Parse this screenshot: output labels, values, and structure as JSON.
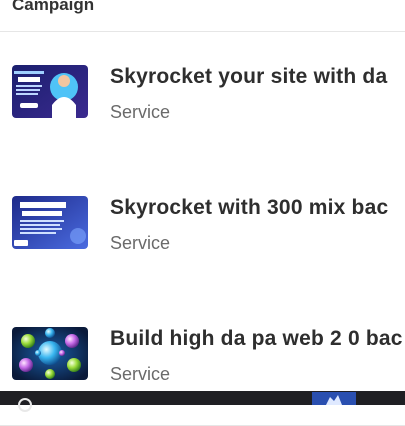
{
  "header": {
    "column_label": "Campaign"
  },
  "rows": [
    {
      "title": "Skyrocket your site with da",
      "subtitle": "Service",
      "thumb_icon": "gig-thumbnail-da-authority"
    },
    {
      "title": "Skyrocket with 300 mix bac",
      "subtitle": "Service",
      "thumb_icon": "gig-thumbnail-dofollow-backlinks"
    },
    {
      "title": "Build high da pa web 2 0 bac",
      "subtitle": "Service",
      "thumb_icon": "gig-thumbnail-web2-spheres"
    }
  ],
  "colors": {
    "divider": "#e6e6e6",
    "taskbar": "#1f1f23",
    "title": "#2e2e2e",
    "subtitle": "#6a6a6a"
  }
}
